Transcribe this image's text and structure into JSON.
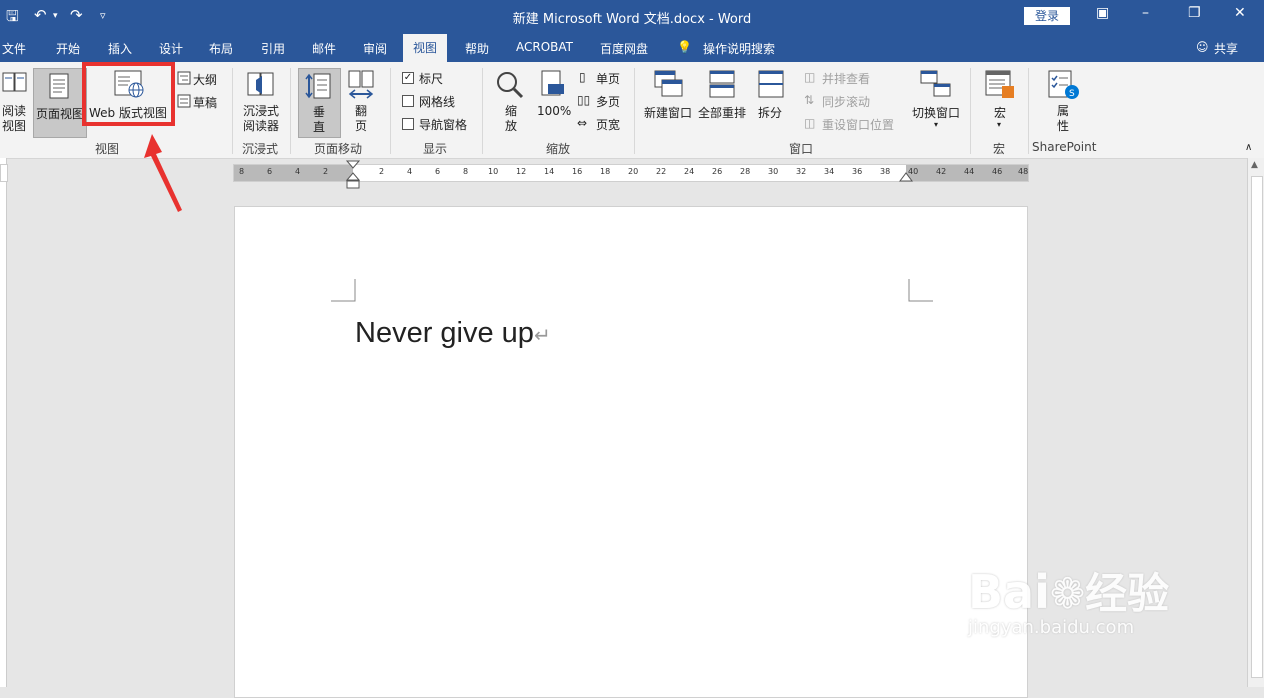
{
  "window": {
    "title": "新建 Microsoft Word 文档.docx - Word",
    "login_label": "登录"
  },
  "tabs": [
    "文件",
    "开始",
    "插入",
    "设计",
    "布局",
    "引用",
    "邮件",
    "审阅",
    "视图",
    "帮助",
    "ACROBAT",
    "百度网盘",
    "操作说明搜索"
  ],
  "active_tab": "视图",
  "share_label": "共享",
  "ribbon": {
    "views": {
      "read_mode": "阅读\n视图",
      "print_layout": "页面视图",
      "web_layout": "Web 版式视图",
      "outline": "大纲",
      "draft": "草稿",
      "group_label": "视图"
    },
    "immersive": {
      "reader": "沉浸式\n阅读器",
      "group_label": "沉浸式"
    },
    "page_movement": {
      "vertical": "垂\n直",
      "side": "翻\n页",
      "group_label": "页面移动"
    },
    "show": {
      "ruler": "标尺",
      "gridlines": "网格线",
      "nav_pane": "导航窗格",
      "group_label": "显示",
      "ruler_checked": true
    },
    "zoom": {
      "zoom": "缩\n放",
      "hundred": "100%",
      "one_page": "单页",
      "multi_page": "多页",
      "page_width": "页宽",
      "group_label": "缩放"
    },
    "window": {
      "new_window": "新建窗口",
      "arrange_all": "全部重排",
      "split": "拆分",
      "side_by_side": "并排查看",
      "sync_scroll": "同步滚动",
      "reset_pos": "重设窗口位置",
      "switch": "切换窗口",
      "group_label": "窗口"
    },
    "macros": {
      "macros": "宏",
      "group_label": "宏"
    },
    "sharepoint": {
      "properties": "属\n性",
      "group_label": "SharePoint"
    }
  },
  "ruler": {
    "numbers_left": [
      "8",
      "6",
      "4",
      "2"
    ],
    "numbers_right": [
      "2",
      "4",
      "6",
      "8",
      "10",
      "12",
      "14",
      "16",
      "18",
      "20",
      "22",
      "24",
      "26",
      "28",
      "30",
      "32",
      "34",
      "36",
      "38",
      "40",
      "42",
      "44",
      "46",
      "48"
    ]
  },
  "document": {
    "text": "Never give up"
  },
  "watermark": {
    "brand": "Bai",
    "brand2": "经验",
    "url": "jingyan.baidu.com"
  },
  "colors": {
    "titlebar": "#2b579a",
    "highlight": "#e8322f"
  }
}
